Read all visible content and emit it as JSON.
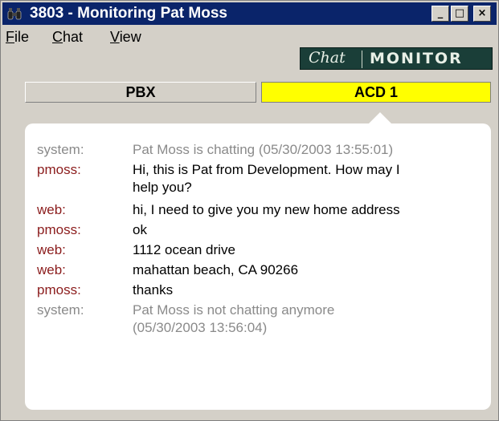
{
  "window": {
    "title": "3803 - Monitoring Pat Moss",
    "app_icon": "binoculars-icon",
    "controls": {
      "minimize": "_",
      "maximize": "□",
      "close": "×"
    }
  },
  "menu": {
    "items": [
      {
        "label": "File",
        "mnemonic": "F",
        "rest": "ile"
      },
      {
        "label": "Chat",
        "mnemonic": "C",
        "rest": "hat"
      },
      {
        "label": "View",
        "mnemonic": "V",
        "rest": "iew"
      }
    ]
  },
  "brand": {
    "script": "Chat",
    "word": "MONITOR",
    "background": "#1a3e38"
  },
  "tabs": [
    {
      "label": "PBX",
      "active": false
    },
    {
      "label": "ACD 1",
      "active": true,
      "color": "#ffff00"
    }
  ],
  "messages": [
    {
      "sender": "system:",
      "text": "Pat Moss is chatting (05/30/2003 13:55:01)",
      "type": "system"
    },
    {
      "sender": "pmoss:",
      "text": "Hi, this is Pat from Development.  How may I\nhelp you?",
      "type": "pmoss"
    },
    {
      "sender": "web:",
      "text": "hi, I need to give you my new home address",
      "type": "web"
    },
    {
      "sender": "pmoss:",
      "text": "ok",
      "type": "pmoss"
    },
    {
      "sender": "web:",
      "text": "1112 ocean drive",
      "type": "web"
    },
    {
      "sender": "web:",
      "text": "mahattan beach, CA 90266",
      "type": "web"
    },
    {
      "sender": "pmoss:",
      "text": "thanks",
      "type": "pmoss"
    },
    {
      "sender": "system:",
      "text": "Pat Moss is not chatting anymore\n(05/30/2003 13:56:04)",
      "type": "system"
    }
  ],
  "colors": {
    "system": "#8a8a8a",
    "user_sender": "#8b1c1c",
    "titlebar": "#0a246a"
  }
}
